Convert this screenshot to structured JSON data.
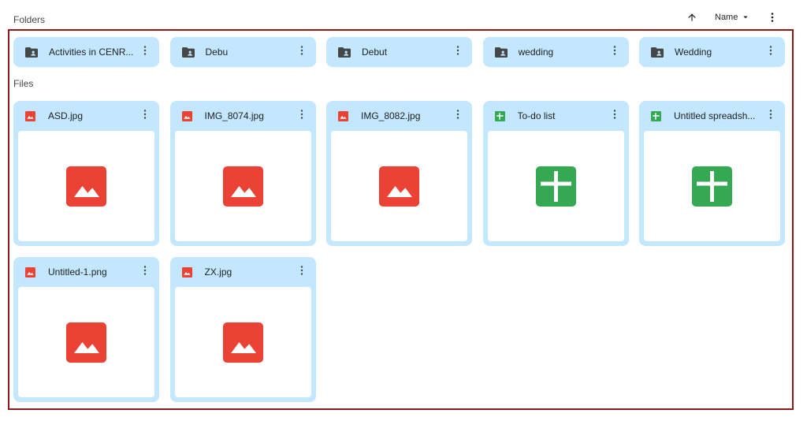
{
  "headings": {
    "folders": "Folders",
    "files": "Files"
  },
  "toolbar": {
    "sort_field": "Name",
    "sort_direction_icon": "arrow-up-icon",
    "more_icon": "more-vert-icon"
  },
  "colors": {
    "tile_background": "#c2e7ff",
    "image_red": "#ea4335",
    "sheets_green": "#34a853",
    "selection_border": "#8b1a1a"
  },
  "folders": [
    {
      "name": "Activities in CENR...",
      "icon": "shared-folder-icon"
    },
    {
      "name": "Debu",
      "icon": "shared-folder-icon"
    },
    {
      "name": "Debut",
      "icon": "shared-folder-icon"
    },
    {
      "name": "wedding",
      "icon": "shared-folder-icon"
    },
    {
      "name": "Wedding",
      "icon": "shared-folder-icon"
    }
  ],
  "files": [
    {
      "name": "ASD.jpg",
      "type": "image"
    },
    {
      "name": "IMG_8074.jpg",
      "type": "image"
    },
    {
      "name": "IMG_8082.jpg",
      "type": "image"
    },
    {
      "name": "To-do list",
      "type": "spreadsheet"
    },
    {
      "name": "Untitled spreadsh...",
      "type": "spreadsheet"
    },
    {
      "name": "Untitled-1.png",
      "type": "image"
    },
    {
      "name": "ZX.jpg",
      "type": "image"
    }
  ]
}
